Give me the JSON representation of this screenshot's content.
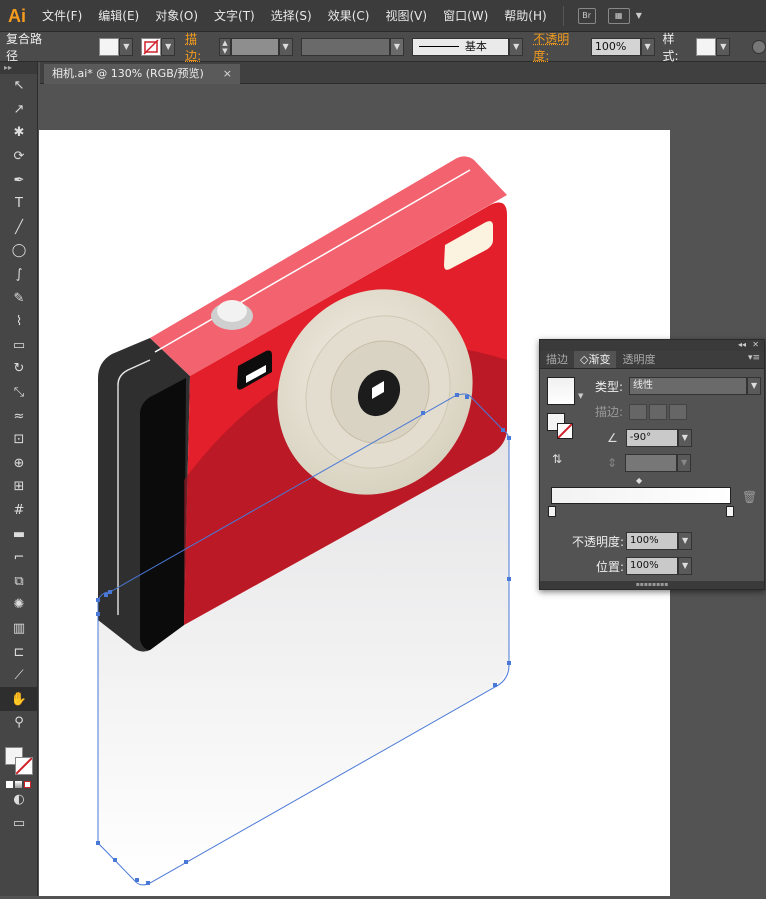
{
  "app": {
    "logo": "Ai"
  },
  "menu": {
    "items": [
      "文件(F)",
      "编辑(E)",
      "对象(O)",
      "文字(T)",
      "选择(S)",
      "效果(C)",
      "视图(V)",
      "窗口(W)",
      "帮助(H)"
    ],
    "bridge_label": "Br"
  },
  "control": {
    "selection_type": "复合路径",
    "stroke_label": "描边:",
    "stroke_style": "基本",
    "opacity_label": "不透明度:",
    "opacity_value": "100%",
    "style_label": "样式:"
  },
  "document": {
    "tab_title": "相机.ai* @ 130% (RGB/预览)",
    "close": "×"
  },
  "tools": [
    "selection-tool",
    "direct-selection-tool",
    "magic-wand-tool",
    "lasso-tool",
    "pen-tool",
    "type-tool",
    "line-tool",
    "ellipse-tool",
    "paintbrush-tool",
    "pencil-tool",
    "blob-brush-tool",
    "eraser-tool",
    "rotate-tool",
    "scale-tool",
    "warp-tool",
    "free-transform-tool",
    "shape-builder-tool",
    "perspective-grid-tool",
    "mesh-tool",
    "gradient-tool",
    "eyedropper-tool",
    "blend-tool",
    "symbol-sprayer-tool",
    "column-graph-tool",
    "artboard-tool",
    "slice-tool",
    "hand-tool",
    "zoom-tool"
  ],
  "gradient_panel": {
    "tabs": [
      "描边",
      "渐变",
      "透明度"
    ],
    "active_tab": "渐变",
    "type_label": "类型:",
    "type_value": "线性",
    "stroke_label": "描边:",
    "angle_value": "-90°",
    "opacity_label": "不透明度:",
    "opacity_value": "100%",
    "location_label": "位置:",
    "location_value": "100%"
  },
  "colors": {
    "camera_red": "#e21f2a",
    "camera_top": "#f25563",
    "camera_side": "#2a2a2a",
    "lens_cream": "#e9e4d6",
    "selection_blue": "#4a78d6"
  }
}
